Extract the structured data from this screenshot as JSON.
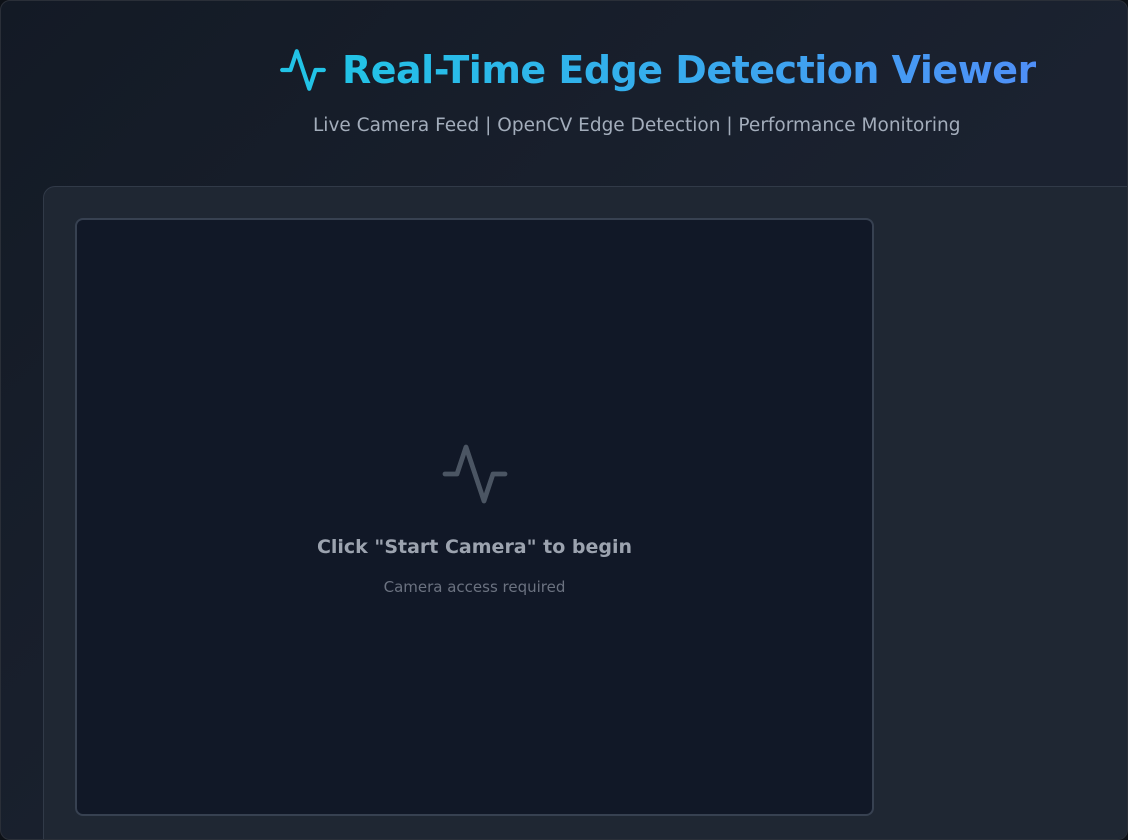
{
  "header": {
    "icon": "activity-pulse-icon",
    "title": "Real-Time Edge Detection Viewer",
    "subtitle": "Live Camera Feed | OpenCV Edge Detection | Performance Monitoring"
  },
  "video": {
    "placeholder_icon": "activity-pulse-icon",
    "placeholder_title": "Click \"Start Camera\" to begin",
    "placeholder_subtitle": "Camera access required"
  },
  "colors": {
    "accent_cyan": "#22c3e6",
    "accent_blue": "#4f8ff7",
    "panel_bg": "#1f2733",
    "video_bg": "#111827",
    "muted_text": "#9ca3af"
  }
}
